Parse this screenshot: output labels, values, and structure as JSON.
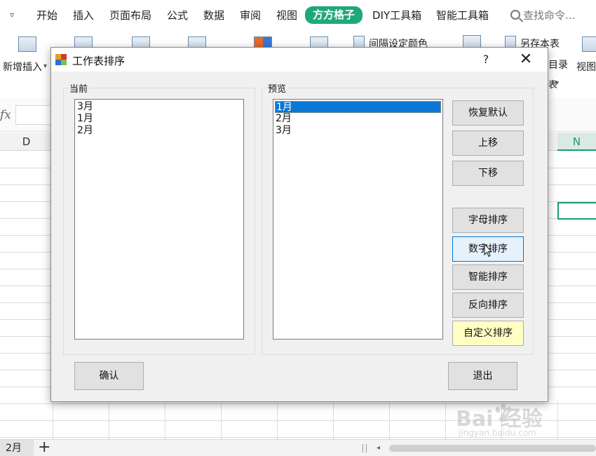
{
  "ribbon": {
    "tabs": [
      {
        "label": "开始"
      },
      {
        "label": "插入"
      },
      {
        "label": "页面布局"
      },
      {
        "label": "公式"
      },
      {
        "label": "数据"
      },
      {
        "label": "审阅"
      },
      {
        "label": "视图"
      },
      {
        "label": "方方格子",
        "active": true
      },
      {
        "label": "DIY工具箱"
      },
      {
        "label": "智能工具箱"
      }
    ],
    "search_placeholder": "查找命令...",
    "tools": {
      "insert_label": "新增插入",
      "interval_color_label": "间隔设定颜色",
      "save_sheet_label": "另存本表",
      "catalog_label": "目录",
      "view_label": "视图",
      "partial_label": "表"
    }
  },
  "formula_bar": {
    "fx_label": "fx"
  },
  "columns": {
    "left": "D",
    "right": "N"
  },
  "sheet_tabs": {
    "current": "2月",
    "add_label": "+"
  },
  "dialog": {
    "title": "工作表排序",
    "help_label": "?",
    "close_label": "✕",
    "current_group_label": "当前",
    "preview_group_label": "预览",
    "current_items": [
      "3月",
      "1月",
      "2月"
    ],
    "preview_items": [
      "1月",
      "2月",
      "3月"
    ],
    "preview_selected_index": 0,
    "buttons": {
      "restore_default": "恢复默认",
      "move_up": "上移",
      "move_down": "下移",
      "alpha_sort": "字母排序",
      "numeric_sort": "数字排序",
      "smart_sort": "智能排序",
      "reverse_sort": "反向排序",
      "custom_sort": "自定义排序",
      "confirm": "确认",
      "exit": "退出"
    }
  },
  "watermark": {
    "main": "Bai  经验",
    "sub": "jingyan.baidu.com"
  },
  "colors": {
    "accent": "#1fa878",
    "selection": "#0a78d7",
    "highlight_button": "#ffffc4"
  }
}
